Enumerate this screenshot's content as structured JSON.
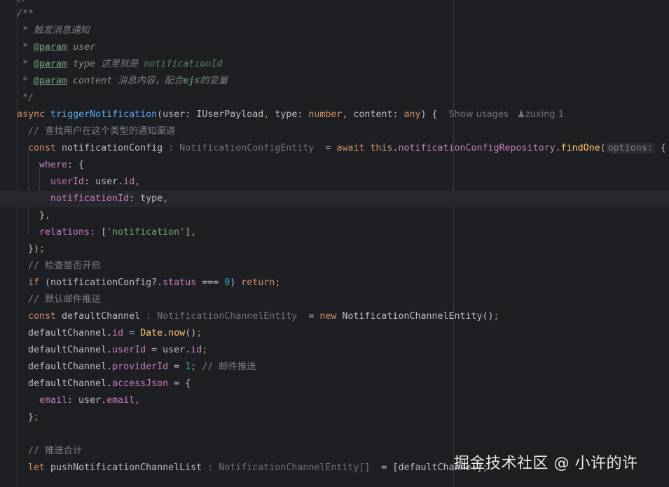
{
  "code": {
    "l0": "@/",
    "l1": "/**",
    "l2_star": " * ",
    "l2_text": "触发消息通知",
    "param_tag": "@param",
    "l3_name": "user",
    "l4_name": "type",
    "l4_desc": "这里就是 ",
    "l4_code": "notificationId",
    "l5_name": "content",
    "l5_desc": "消息内容，配合",
    "l5_code": "ejs",
    "l5_desc2": "的变量",
    "l6": " */",
    "l7_async": "async",
    "l7_fn": "triggerNotification",
    "l7_p1": "user",
    "l7_t1": "IUserPayload",
    "l7_p2": "type",
    "l7_t2": "number",
    "l7_p3": "content",
    "l7_t3": "any",
    "l7_usage": "Show usages",
    "l7_author": "zuxing 1",
    "l8": "// 查找用户在这个类型的通知渠道",
    "l9_const": "const",
    "l9_var": "notificationConfig",
    "l9_hint": ": NotificationConfigEntity",
    "l9_await": "await",
    "l9_this": "this",
    "l9_repo": "notificationConfigRepository",
    "l9_fn": "findOne",
    "l9_opt": "options:",
    "l10_where": "where",
    "l11_key": "userId",
    "l11_obj": "user",
    "l11_prop": "id",
    "l12_key": "notificationId",
    "l12_val": "type",
    "l14_key": "relations",
    "l14_str": "'notification'",
    "l16": "// 检查是否开启",
    "l17_if": "if",
    "l17_var": "notificationConfig",
    "l17_prop": "status",
    "l17_num": "0",
    "l17_ret": "return",
    "l18": "// 默认邮件推送",
    "l19_const": "const",
    "l19_var": "defaultChannel",
    "l19_hint": ": NotificationChannelEntity",
    "l19_new": "new",
    "l19_cls": "NotificationChannelEntity",
    "l20_obj": "defaultChannel",
    "l20_prop": "id",
    "l20_cls": "Date",
    "l20_fn": "now",
    "l21_prop": "userId",
    "l21_obj": "user",
    "l21_p2": "id",
    "l22_prop": "providerId",
    "l22_num": "1",
    "l22_cm": "// 邮件推送",
    "l23_prop": "accessJson",
    "l24_key": "email",
    "l24_obj": "user",
    "l24_prop": "email",
    "l27": "// 推送合计",
    "l28_let": "let",
    "l28_var": "pushNotificationChannelList",
    "l28_hint": ": NotificationChannelEntity[]",
    "l28_val": "defaultChannel"
  },
  "watermark": "掘金技术社区 @ 小许的许",
  "colors": {
    "background": "#1e1f22",
    "keyword": "#cf8e6d",
    "function": "#56a8f5",
    "property": "#c77dbb",
    "string": "#6aab73",
    "number": "#2aacb8",
    "comment": "#7a7e85"
  }
}
